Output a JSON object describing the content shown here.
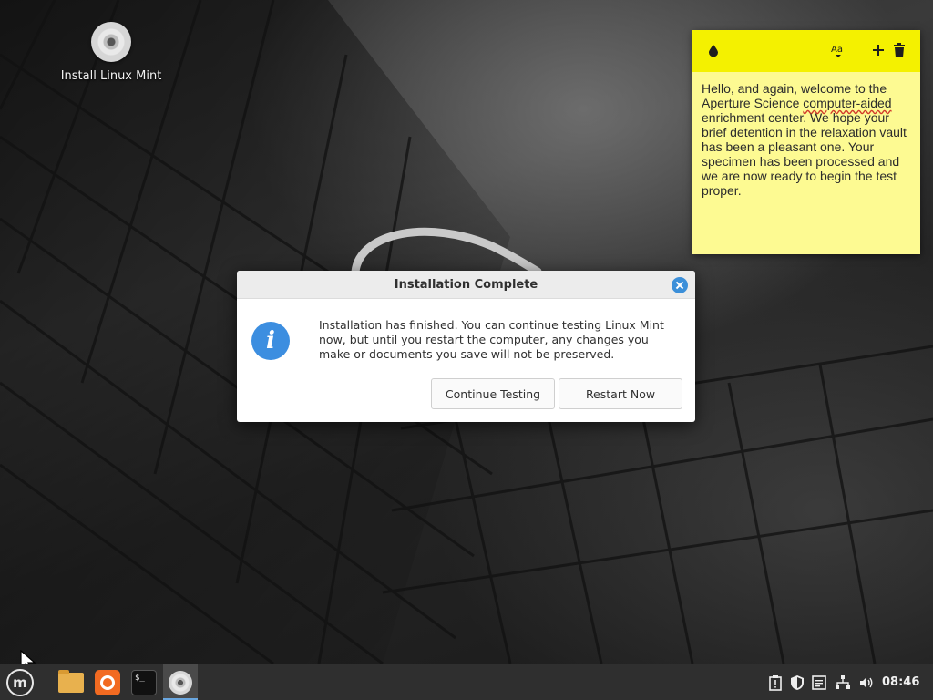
{
  "desktop": {
    "icons": [
      {
        "label": "Install Linux Mint",
        "icon": "dvd-disc-icon"
      }
    ]
  },
  "sticky_note": {
    "icons": [
      "color-drop-icon",
      "font-size-icon",
      "add-note-icon",
      "trash-icon"
    ],
    "text_before": "Hello, and again, welcome to the Aperture Science ",
    "text_misspelled": "computer-aided",
    "text_after": " enrichment center. We hope your brief detention in the relaxation vault has been a pleasant one. Your specimen has been processed and we are now ready to begin the test proper.",
    "background_color": "#fdfa92",
    "header_color": "#f4f100"
  },
  "dialog": {
    "title": "Installation Complete",
    "icon": "info-icon",
    "message": "Installation has finished.  You can continue testing Linux Mint now, but until you restart the computer, any changes you make or documents you save will not be preserved.",
    "buttons": {
      "continue": "Continue Testing",
      "restart": "Restart Now"
    },
    "accent_color": "#3b8fd9"
  },
  "taskbar": {
    "menu_icon": "linux-mint-menu-icon",
    "apps": [
      {
        "name": "Files",
        "icon": "folder-icon"
      },
      {
        "name": "Firefox",
        "icon": "firefox-icon"
      },
      {
        "name": "Terminal",
        "icon": "terminal-icon",
        "glyph": "$_"
      },
      {
        "name": "Install Linux Mint",
        "icon": "dvd-disc-icon",
        "active": true
      }
    ],
    "tray_icons": [
      "clipboard-icon",
      "shield-update-icon",
      "notes-icon",
      "network-icon",
      "volume-icon"
    ],
    "clock": "08:46"
  }
}
